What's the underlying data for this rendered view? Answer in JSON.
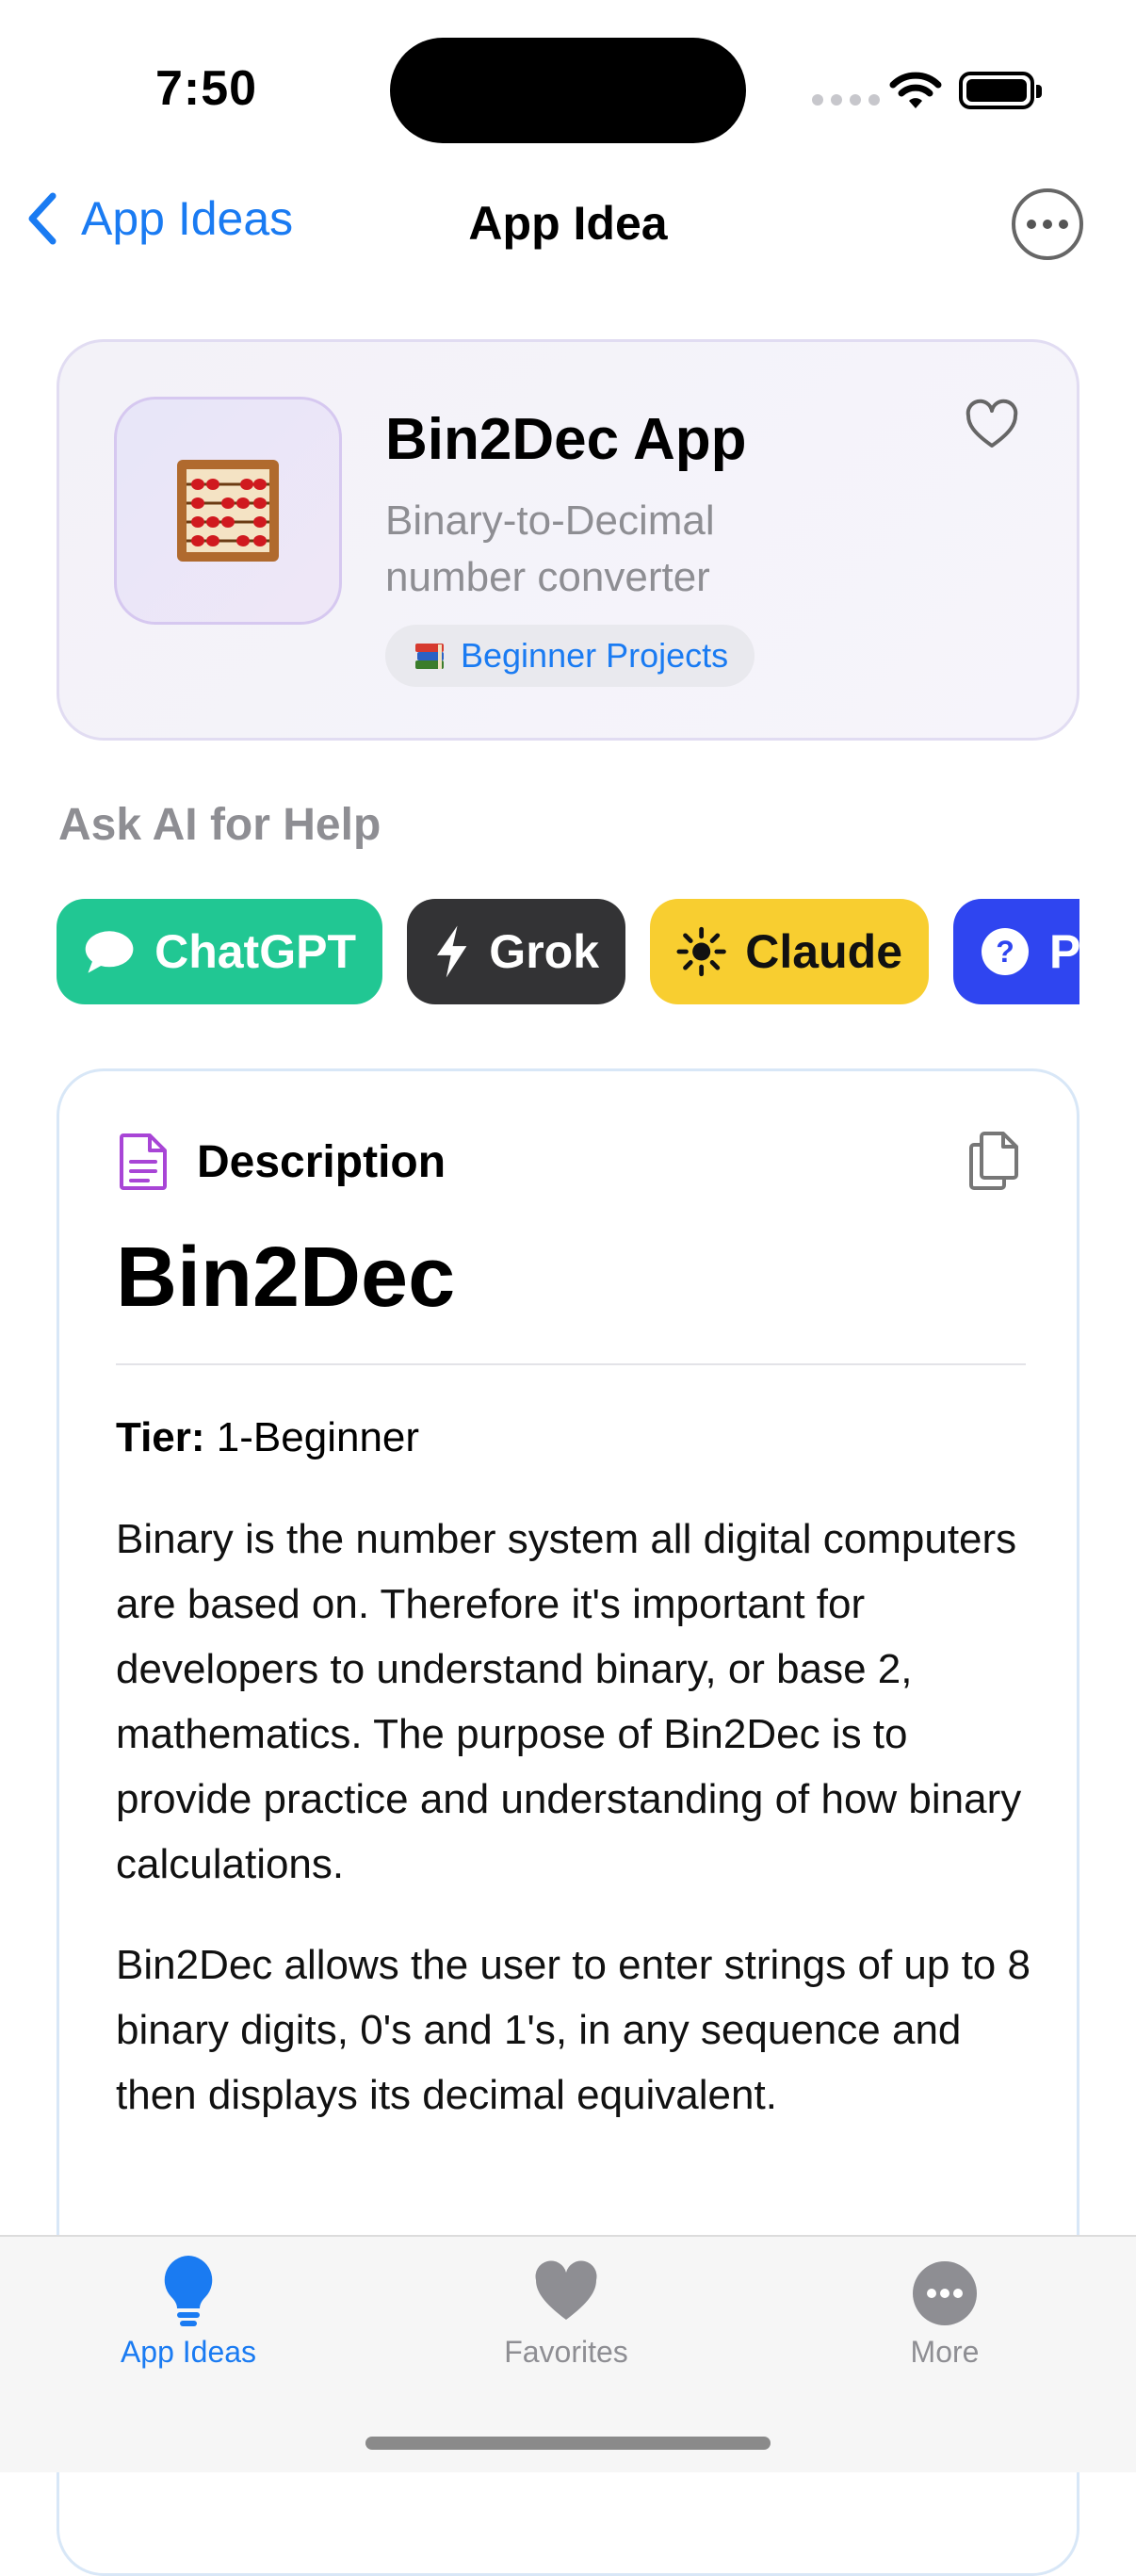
{
  "status": {
    "time": "7:50"
  },
  "nav": {
    "back_label": "App Ideas",
    "title": "App Idea"
  },
  "hero": {
    "app_name": "Bin2Dec App",
    "subtitle": "Binary-to-Decimal number converter",
    "category": "Beginner Projects",
    "icon": "abacus-icon",
    "favorited": false
  },
  "ask_ai": {
    "label": "Ask AI for Help",
    "buttons": [
      {
        "label": "ChatGPT",
        "icon": "chat-bubble-icon",
        "color": "#21c793"
      },
      {
        "label": "Grok",
        "icon": "bolt-icon",
        "color": "#333335"
      },
      {
        "label": "Claude",
        "icon": "sun-icon",
        "color": "#f8ce30"
      },
      {
        "label": "P",
        "icon": "question-circle-icon",
        "color": "#2f45f0"
      }
    ]
  },
  "description": {
    "header": "Description",
    "title": "Bin2Dec",
    "tier_label": "Tier:",
    "tier_value": "1-Beginner",
    "paragraphs": [
      "Binary is the number system all digital computers are based on. Therefore it's important for developers to understand binary, or base 2, mathematics. The purpose of Bin2Dec is to provide practice and understanding of how binary calculations.",
      "Bin2Dec allows the user to enter strings of up to 8 binary digits, 0's and 1's, in any sequence and then displays its decimal equivalent."
    ]
  },
  "tabbar": {
    "tabs": [
      {
        "label": "App Ideas",
        "icon": "lightbulb-icon",
        "selected": true
      },
      {
        "label": "Favorites",
        "icon": "heart-icon",
        "selected": false
      },
      {
        "label": "More",
        "icon": "ellipsis-circle-icon",
        "selected": false
      }
    ]
  },
  "colors": {
    "accent": "#1a7bf2",
    "secondary_text": "#8e8e93"
  }
}
